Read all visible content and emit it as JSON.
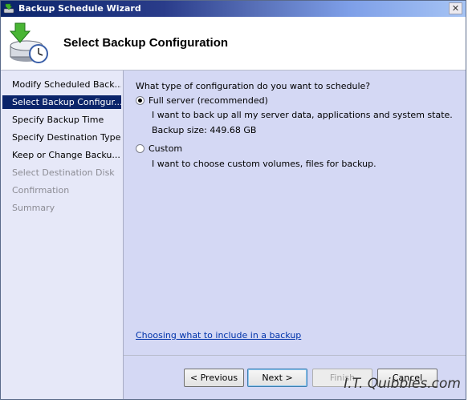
{
  "window": {
    "title": "Backup Schedule Wizard",
    "close_glyph": "✕"
  },
  "header": {
    "title": "Select Backup Configuration",
    "icon": "backup-schedule-icon"
  },
  "sidebar": {
    "items": [
      {
        "label": "Modify Scheduled Back...",
        "state": "normal"
      },
      {
        "label": "Select Backup Configur...",
        "state": "active"
      },
      {
        "label": "Specify Backup Time",
        "state": "normal"
      },
      {
        "label": "Specify Destination Type",
        "state": "normal"
      },
      {
        "label": "Keep or Change Backu...",
        "state": "normal"
      },
      {
        "label": "Select Destination Disk",
        "state": "disabled"
      },
      {
        "label": "Confirmation",
        "state": "disabled"
      },
      {
        "label": "Summary",
        "state": "disabled"
      }
    ]
  },
  "main": {
    "question": "What type of configuration do you want to schedule?",
    "options": [
      {
        "label": "Full server (recommended)",
        "selected": true,
        "description": "I want to back up all my server data, applications and system state.",
        "detail": "Backup size: 449.68 GB"
      },
      {
        "label": "Custom",
        "selected": false,
        "description": "I want to choose custom volumes, files for backup."
      }
    ],
    "help_link": "Choosing what to include in a backup"
  },
  "buttons": {
    "previous": "< Previous",
    "next": "Next >",
    "finish": "Finish",
    "cancel": "Cancel"
  },
  "watermark": "I.T. Quibbles.com",
  "colors": {
    "selection": "#0a246a",
    "panel": "#d4d8f4",
    "link": "#0033aa"
  }
}
